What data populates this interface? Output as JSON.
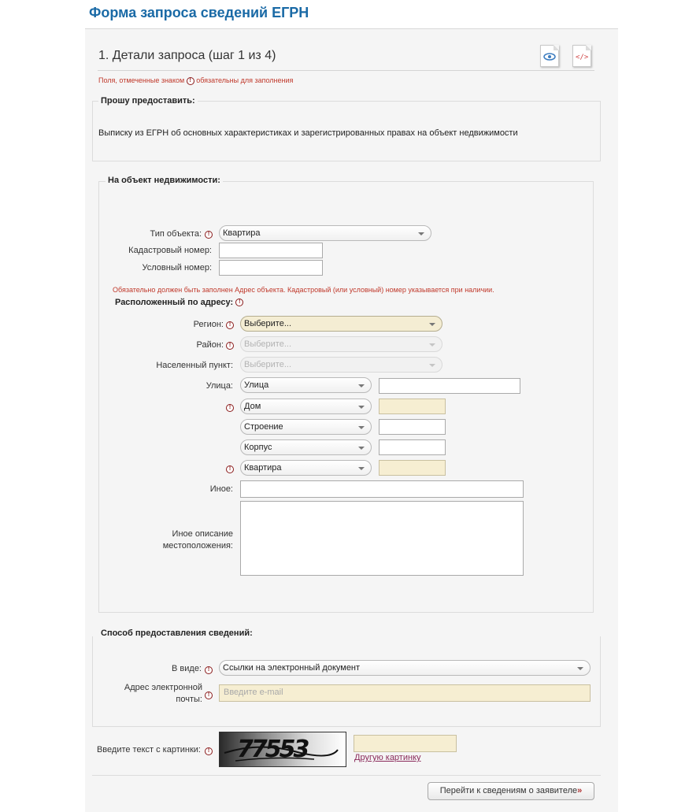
{
  "page": {
    "title": "Форма запроса сведений ЕГРН"
  },
  "step": {
    "title": "1. Детали запроса (шаг 1 из 4)"
  },
  "toolbar": {
    "preview_icon": "eye-document-icon",
    "code_icon": "code-document-icon"
  },
  "required_note": {
    "before": "Поля, отмеченные знаком",
    "after": "обязательны для заполнения",
    "icon": "!"
  },
  "request_section": {
    "legend": "Прошу предоставить:",
    "text": "Выписку из ЕГРН об основных характеристиках и зарегистрированных правах на объект недвижимости"
  },
  "object_section": {
    "legend": "На объект недвижимости:",
    "object_type": {
      "label": "Тип объекта:",
      "value": "Квартира"
    },
    "cadastral": {
      "label": "Кадастровый номер:",
      "value": ""
    },
    "conditional": {
      "label": "Условный номер:",
      "value": ""
    },
    "address_note": "Обязательно должен быть заполнен Адрес объекта. Кадастровый (или условный) номер указывается при наличии.",
    "address_heading": "Расположенный по адресу:",
    "region": {
      "label": "Регион:",
      "value": "Выберите..."
    },
    "district": {
      "label": "Район:",
      "value": "Выберите..."
    },
    "locality": {
      "label": "Населенный пункт:",
      "value": "Выберите..."
    },
    "street": {
      "label": "Улица:",
      "type_value": "Улица",
      "value": ""
    },
    "house": {
      "type_value": "Дом",
      "value": ""
    },
    "building": {
      "type_value": "Строение",
      "value": ""
    },
    "block": {
      "type_value": "Корпус",
      "value": ""
    },
    "apartment": {
      "type_value": "Квартира",
      "value": ""
    },
    "other": {
      "label": "Иное:",
      "value": ""
    },
    "other_location": {
      "label_line1": "Иное описание",
      "label_line2": "местоположения:",
      "value": ""
    }
  },
  "delivery_section": {
    "legend": "Способ предоставления сведений:",
    "form": {
      "label": "В виде:",
      "value": "Ссылки на электронный документ"
    },
    "email": {
      "label_line1": "Адрес электронной",
      "label_line2": "почты:",
      "placeholder": "Введите e-mail"
    }
  },
  "captcha": {
    "label": "Введите текст с картинки:",
    "image_text": "77553",
    "value": "",
    "refresh_link": "Другую картинку"
  },
  "next_button": {
    "label": "Перейти к сведениям о заявителе",
    "arrow": "»"
  }
}
